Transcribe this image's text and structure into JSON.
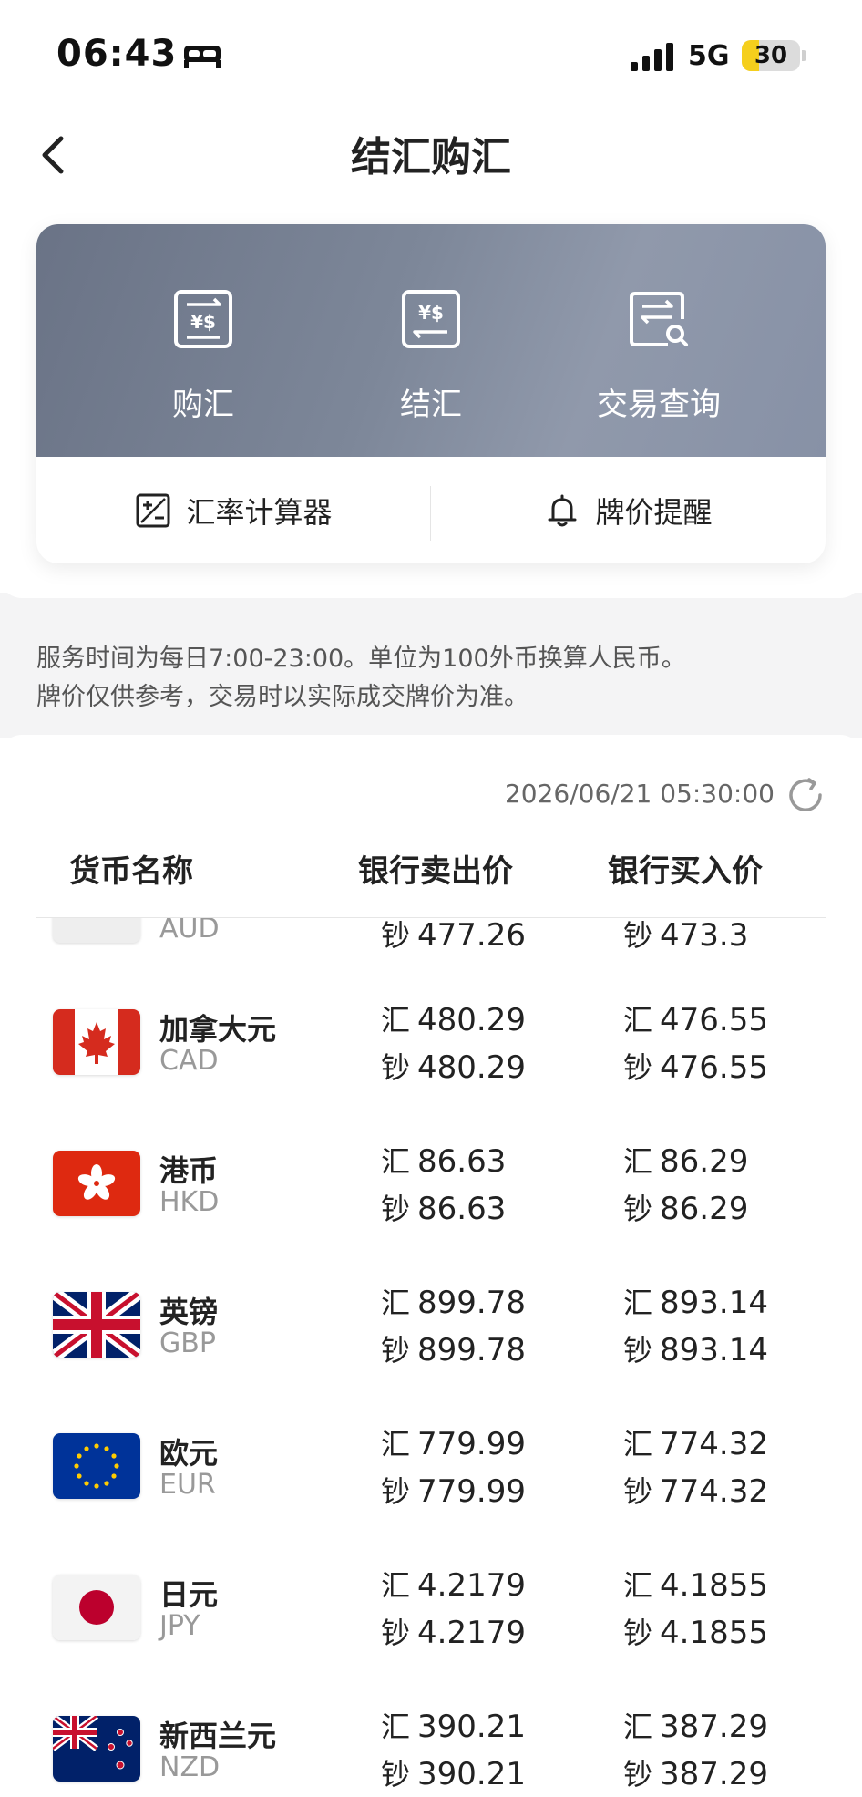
{
  "status_bar": {
    "time": "06:43",
    "network": "5G",
    "battery": "30",
    "battery_level_percent": 30,
    "icons": [
      "sleep-bed-icon",
      "signal-bars-icon"
    ]
  },
  "nav": {
    "title": "结汇购汇",
    "back_icon": "chevron-left-icon"
  },
  "actions": [
    {
      "label": "购汇",
      "icon": "buy-fx-icon"
    },
    {
      "label": "结汇",
      "icon": "settle-fx-icon"
    },
    {
      "label": "交易查询",
      "icon": "transaction-query-icon"
    }
  ],
  "tools": [
    {
      "label": "汇率计算器",
      "icon": "calculator-icon"
    },
    {
      "label": "牌价提醒",
      "icon": "bell-icon"
    }
  ],
  "notice": {
    "line1": "服务时间为每日7:00-23:00。单位为100外币换算人民币。",
    "line2": "牌价仅供参考，交易时以实际成交牌价为准。"
  },
  "rates": {
    "updated": "2026/06/21 05:30:00",
    "columns": [
      "货币名称",
      "银行卖出价",
      "银行买入价"
    ],
    "prefix_spot": "汇",
    "prefix_cash": "钞",
    "partial_row": {
      "code": "AUD",
      "sell_cash": "477.26",
      "buy_cash": "473.3"
    },
    "rows": [
      {
        "name": "加拿大元",
        "code": "CAD",
        "flag": "canada-flag",
        "sell_spot": "480.29",
        "sell_cash": "480.29",
        "buy_spot": "476.55",
        "buy_cash": "476.55"
      },
      {
        "name": "港币",
        "code": "HKD",
        "flag": "hong-kong-flag",
        "sell_spot": "86.63",
        "sell_cash": "86.63",
        "buy_spot": "86.29",
        "buy_cash": "86.29"
      },
      {
        "name": "英镑",
        "code": "GBP",
        "flag": "uk-flag",
        "sell_spot": "899.78",
        "sell_cash": "899.78",
        "buy_spot": "893.14",
        "buy_cash": "893.14"
      },
      {
        "name": "欧元",
        "code": "EUR",
        "flag": "eu-flag",
        "sell_spot": "779.99",
        "sell_cash": "779.99",
        "buy_spot": "774.32",
        "buy_cash": "774.32"
      },
      {
        "name": "日元",
        "code": "JPY",
        "flag": "japan-flag",
        "sell_spot": "4.2179",
        "sell_cash": "4.2179",
        "buy_spot": "4.1855",
        "buy_cash": "4.1855"
      },
      {
        "name": "新西兰元",
        "code": "NZD",
        "flag": "new-zealand-flag",
        "sell_spot": "390.21",
        "sell_cash": "390.21",
        "buy_spot": "387.29",
        "buy_cash": "387.29"
      }
    ]
  }
}
